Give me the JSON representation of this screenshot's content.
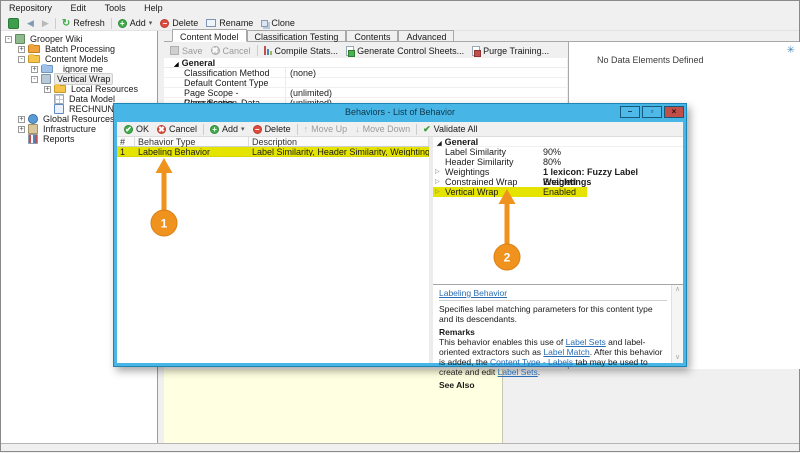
{
  "menu": {
    "items": [
      "Repository",
      "Edit",
      "Tools",
      "Help"
    ]
  },
  "main_toolbar": {
    "refresh": "Refresh",
    "add": "Add",
    "delete": "Delete",
    "rename": "Rename",
    "clone": "Clone"
  },
  "tree": {
    "items": [
      {
        "label": "Grooper Wiki",
        "exp": "-"
      },
      {
        "label": "Batch Processing",
        "exp": "+"
      },
      {
        "label": "Content Models",
        "exp": "-"
      },
      {
        "label": "_ignore me",
        "exp": "+"
      },
      {
        "label": "Vertical Wrap",
        "exp": "-"
      },
      {
        "label": "Local Resources",
        "exp": "+"
      },
      {
        "label": "Data Model",
        "exp": ""
      },
      {
        "label": "RECHNUNG",
        "exp": ""
      },
      {
        "label": "Global Resources",
        "exp": "+"
      },
      {
        "label": "Infrastructure",
        "exp": "+"
      },
      {
        "label": "Reports",
        "exp": ""
      }
    ]
  },
  "tabs": {
    "t0": "Content Model",
    "t1": "Classification Testing",
    "t2": "Contents",
    "t3": "Advanced"
  },
  "panel_toolbar": {
    "save": "Save",
    "cancel": "Cancel",
    "compile": "Compile Stats...",
    "generate": "Generate Control Sheets...",
    "purge": "Purge Training..."
  },
  "property_grid": {
    "category": "General",
    "rows": [
      {
        "name": "Classification Method",
        "value": "(none)"
      },
      {
        "name": "Default Content Type",
        "value": ""
      },
      {
        "name": "Page Scope - Classification",
        "value": "(unlimited)"
      },
      {
        "name": "Page Scope - Data Extraction",
        "value": "(unlimited)"
      }
    ]
  },
  "data_panel": {
    "empty_text": "No Data Elements Defined"
  },
  "dialog": {
    "title": "Behaviors - List of Behavior",
    "toolbar": {
      "ok": "OK",
      "cancel": "Cancel",
      "add": "Add",
      "delete": "Delete",
      "move_up": "Move Up",
      "move_down": "Move Down",
      "validate_all": "Validate All"
    },
    "list": {
      "columns": {
        "num": "#",
        "type": "Behavior Type",
        "desc": "Description"
      },
      "row": {
        "num": "1",
        "type": "Labeling Behavior",
        "desc": "Label Similarity, Header Similarity, Weightings, Constrained ..."
      }
    },
    "props": {
      "category": "General",
      "rows": [
        {
          "name": "Label Similarity",
          "value": "90%"
        },
        {
          "name": "Header Similarity",
          "value": "80%"
        },
        {
          "name": "Weightings",
          "value": "1 lexicon: Fuzzy Label Weightings"
        },
        {
          "name": "Constrained Wrap",
          "value": "Enabled"
        },
        {
          "name": "Vertical Wrap",
          "value": "Enabled"
        }
      ]
    },
    "help": {
      "title": "Labeling Behavior",
      "summary": "Specifies label matching parameters for this content type and its descendants.",
      "remarks_label": "Remarks",
      "remarks": {
        "t1": "This behavior enables this use of ",
        "l1": "Label Sets",
        "t2": " and label-oriented extractors such as ",
        "l2": "Label Match",
        "t3": ". After this behavior is added, the ",
        "l3": "Content Type - Labels",
        "t4": " tab may be used to create and edit ",
        "l4": "Label Sets",
        "t5": "."
      },
      "see_also": "See Also"
    }
  },
  "callouts": {
    "one": "1",
    "two": "2"
  },
  "icons": {
    "minimize": "–",
    "maximize": "▫",
    "close": "×",
    "dropdown": "▾",
    "back": "◀",
    "forward": "▶",
    "refresh": "↻",
    "check": "✔",
    "cross": "✖",
    "plus": "+",
    "minus": "−",
    "up": "↑",
    "down": "↓",
    "collapse": "◢",
    "expand": "▷",
    "sparkle": "✳",
    "scroll_up": "∧",
    "scroll_down": "∨"
  },
  "colors": {
    "accent_blue": "#47b6e7",
    "highlight_yellow": "#e4e400",
    "callout_orange": "#f0921e"
  }
}
